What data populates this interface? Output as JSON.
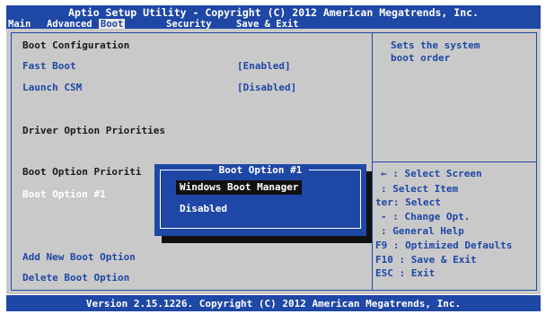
{
  "window": {
    "title": "Aptio Setup Utility - Copyright (C) 2012 American Megatrends, Inc.",
    "footer": "Version 2.15.1226. Copyright (C) 2012 American Megatrends, Inc."
  },
  "menu": {
    "items": [
      "Main",
      "Advanced",
      "Boot",
      "Security",
      "Save & Exit"
    ],
    "active": "Boot"
  },
  "boot": {
    "section_boot_config": "Boot Configuration",
    "fast_boot_label": "Fast Boot",
    "fast_boot_value": "[Enabled]",
    "launch_csm_label": "Launch CSM",
    "launch_csm_value": "[Disabled]",
    "section_driver": "Driver Option Priorities",
    "section_boot_option": "Boot Option Prioriti",
    "boot_option_1": "Boot Option #1",
    "add_new": "Add New Boot Option",
    "delete": "Delete Boot Option"
  },
  "help": {
    "description_line1": "Sets the system",
    "description_line2": "boot order",
    "keys": [
      "←  : Select Screen",
      "   : Select Item",
      "ter: Select",
      "-  : Change Opt.",
      "   : General Help",
      "F9   : Optimized Defaults",
      "F10  : Save & Exit",
      "ESC  : Exit"
    ]
  },
  "popup": {
    "title": "Boot Option #1",
    "options": [
      "Windows Boot Manager",
      "Disabled"
    ],
    "selected": "Windows Boot Manager"
  },
  "colors": {
    "bios_blue": "#1f47a6",
    "panel_gray": "#c9c9c9",
    "selection_black": "#111111"
  }
}
